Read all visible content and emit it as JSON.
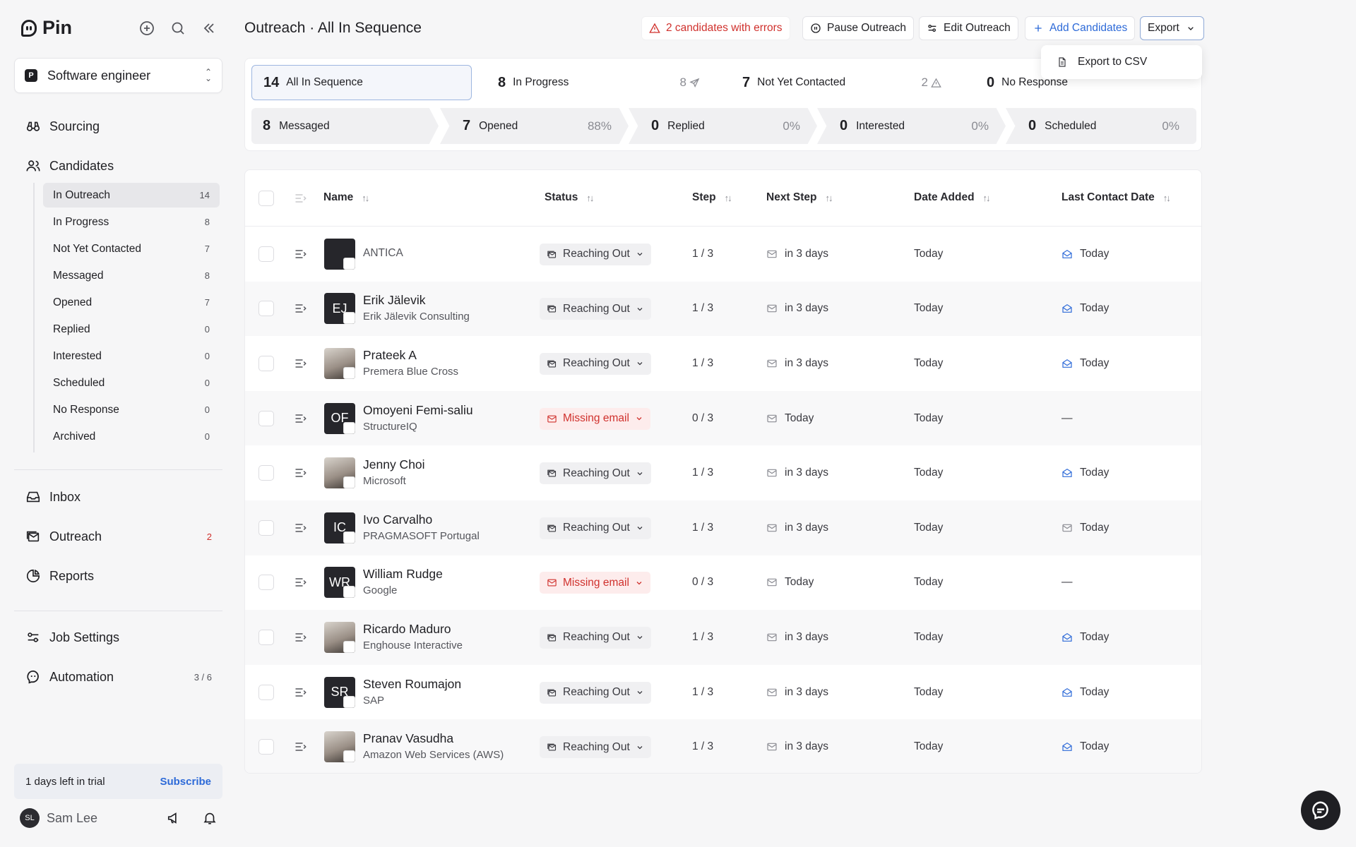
{
  "app": {
    "name": "Pin"
  },
  "sidebar": {
    "job": {
      "badge": "P",
      "label": "Software engineer"
    },
    "nav": [
      {
        "label": "Sourcing",
        "icon": "binoculars-icon"
      },
      {
        "label": "Candidates",
        "icon": "users-icon"
      }
    ],
    "candidates_sub": [
      {
        "label": "In Outreach",
        "count": "14",
        "active": true
      },
      {
        "label": "In Progress",
        "count": "8"
      },
      {
        "label": "Not Yet Contacted",
        "count": "7"
      },
      {
        "label": "Messaged",
        "count": "8"
      },
      {
        "label": "Opened",
        "count": "7"
      },
      {
        "label": "Replied",
        "count": "0"
      },
      {
        "label": "Interested",
        "count": "0"
      },
      {
        "label": "Scheduled",
        "count": "0"
      },
      {
        "label": "No Response",
        "count": "0"
      },
      {
        "label": "Archived",
        "count": "0"
      }
    ],
    "nav2": [
      {
        "label": "Inbox",
        "icon": "inbox-icon",
        "count": ""
      },
      {
        "label": "Outreach",
        "icon": "outreach-icon",
        "count": "2"
      },
      {
        "label": "Reports",
        "icon": "pie-chart-icon",
        "count": ""
      }
    ],
    "nav3": [
      {
        "label": "Job Settings",
        "icon": "sliders-icon",
        "count": ""
      },
      {
        "label": "Automation",
        "icon": "automation-icon",
        "count": "3 / 6"
      }
    ],
    "trial": {
      "text": "1 days left in trial",
      "cta": "Subscribe"
    },
    "user": {
      "initials": "SL",
      "name": "Sam Lee"
    }
  },
  "header": {
    "title": "Outreach · All In Sequence",
    "errors": "2 candidates with errors",
    "pause": "Pause Outreach",
    "edit": "Edit Outreach",
    "add": "Add Candidates",
    "export": "Export",
    "export_menu": "Export to CSV"
  },
  "stats": {
    "tabs": [
      {
        "count": "14",
        "label": "All In Sequence",
        "extra": ""
      },
      {
        "count": "8",
        "label": "In Progress",
        "extra": "8"
      },
      {
        "count": "7",
        "label": "Not Yet Contacted",
        "extra": "2"
      },
      {
        "count": "0",
        "label": "No Response",
        "extra": ""
      }
    ],
    "funnel": [
      {
        "count": "8",
        "label": "Messaged",
        "pct": ""
      },
      {
        "count": "7",
        "label": "Opened",
        "pct": "88%"
      },
      {
        "count": "0",
        "label": "Replied",
        "pct": "0%"
      },
      {
        "count": "0",
        "label": "Interested",
        "pct": "0%"
      },
      {
        "count": "0",
        "label": "Scheduled",
        "pct": "0%"
      }
    ]
  },
  "table": {
    "columns": {
      "name": "Name",
      "status": "Status",
      "step": "Step",
      "next": "Next Step",
      "added": "Date Added",
      "last": "Last Contact Date"
    },
    "rows": [
      {
        "name": "ANTICA",
        "company": "",
        "initials": "",
        "photo": false,
        "status": "Reaching Out",
        "error": false,
        "step": "1 / 3",
        "next": "in 3 days",
        "added": "Today",
        "last": "Today",
        "last_opened": true
      },
      {
        "name": "Erik Jälevik",
        "company": "Erik Jälevik Consulting",
        "initials": "EJ",
        "photo": false,
        "status": "Reaching Out",
        "error": false,
        "step": "1 / 3",
        "next": "in 3 days",
        "added": "Today",
        "last": "Today",
        "last_opened": true
      },
      {
        "name": "Prateek A",
        "company": "Premera Blue Cross",
        "initials": "",
        "photo": true,
        "status": "Reaching Out",
        "error": false,
        "step": "1 / 3",
        "next": "in 3 days",
        "added": "Today",
        "last": "Today",
        "last_opened": true
      },
      {
        "name": "Omoyeni Femi-saliu",
        "company": "StructureIQ",
        "initials": "OF",
        "photo": false,
        "status": "Missing email",
        "error": true,
        "step": "0 / 3",
        "next": "Today",
        "added": "Today",
        "last": "—",
        "last_opened": false
      },
      {
        "name": "Jenny Choi",
        "company": "Microsoft",
        "initials": "",
        "photo": true,
        "status": "Reaching Out",
        "error": false,
        "step": "1 / 3",
        "next": "in 3 days",
        "added": "Today",
        "last": "Today",
        "last_opened": true
      },
      {
        "name": "Ivo Carvalho",
        "company": "PRAGMASOFT Portugal",
        "initials": "IC",
        "photo": false,
        "status": "Reaching Out",
        "error": false,
        "step": "1 / 3",
        "next": "in 3 days",
        "added": "Today",
        "last": "Today",
        "last_opened": false
      },
      {
        "name": "William Rudge",
        "company": "Google",
        "initials": "WR",
        "photo": false,
        "status": "Missing email",
        "error": true,
        "step": "0 / 3",
        "next": "Today",
        "added": "Today",
        "last": "—",
        "last_opened": false
      },
      {
        "name": "Ricardo Maduro",
        "company": "Enghouse Interactive",
        "initials": "",
        "photo": true,
        "status": "Reaching Out",
        "error": false,
        "step": "1 / 3",
        "next": "in 3 days",
        "added": "Today",
        "last": "Today",
        "last_opened": true
      },
      {
        "name": "Steven Roumajon",
        "company": "SAP",
        "initials": "SR",
        "photo": false,
        "status": "Reaching Out",
        "error": false,
        "step": "1 / 3",
        "next": "in 3 days",
        "added": "Today",
        "last": "Today",
        "last_opened": true
      },
      {
        "name": "Pranav Vasudha",
        "company": "Amazon Web Services (AWS)",
        "initials": "",
        "photo": true,
        "status": "Reaching Out",
        "error": false,
        "step": "1 / 3",
        "next": "in 3 days",
        "added": "Today",
        "last": "Today",
        "last_opened": true
      }
    ]
  },
  "colors": {
    "accent": "#2d6ad8",
    "error": "#d0312d"
  }
}
